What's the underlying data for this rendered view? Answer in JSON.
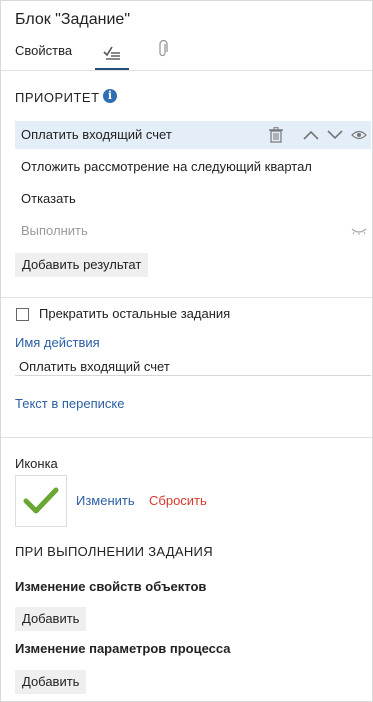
{
  "header": {
    "title": "Блок \"Задание\"",
    "tabs": [
      {
        "label": "Свойства",
        "active": false
      },
      {
        "label": "",
        "icon": "list-check-icon",
        "active": true
      },
      {
        "label": "",
        "icon": "paperclip-icon",
        "active": false
      }
    ]
  },
  "priority": {
    "title": "ПРИОРИТЕТ",
    "info": "i",
    "results": [
      {
        "label": "Оплатить входящий счет",
        "selected": true
      },
      {
        "label": "Отложить рассмотрение на следующий квартал",
        "selected": false
      },
      {
        "label": "Отказать",
        "selected": false
      },
      {
        "label": "Выполнить",
        "selected": false,
        "hidden": true
      }
    ],
    "add_button": "Добавить результат"
  },
  "options": {
    "stop_others_label": "Прекратить остальные задания",
    "stop_others_checked": false,
    "action_name_label": "Имя действия",
    "action_name_value": "Оплатить входящий счет",
    "correspondence_link": "Текст в переписке"
  },
  "icon_section": {
    "label": "Иконка",
    "change": "Изменить",
    "reset": "Сбросить",
    "icon_color": "#6aa632"
  },
  "on_complete": {
    "title": "ПРИ ВЫПОЛНЕНИИ ЗАДАНИЯ",
    "object_props_title": "Изменение свойств объектов",
    "object_props_add": "Добавить",
    "process_params_title": "Изменение параметров процесса",
    "process_params_add": "Добавить"
  },
  "colors": {
    "accent": "#1e4e79",
    "link": "#2b5ea5",
    "reset": "#d9382b",
    "selected_row": "#e3eef9"
  }
}
